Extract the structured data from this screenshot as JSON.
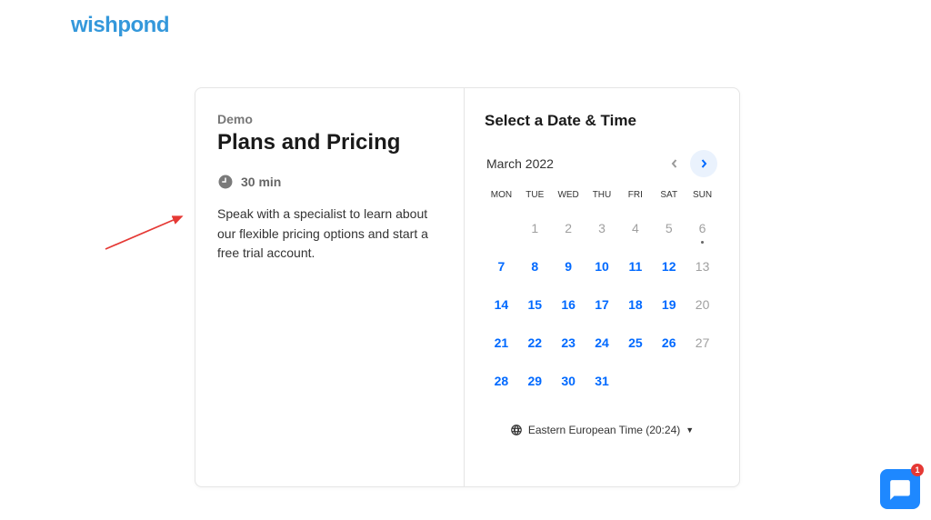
{
  "brand": "wishpond",
  "panel": {
    "eyebrow": "Demo",
    "title": "Plans and Pricing",
    "duration": "30 min",
    "description": "Speak with a specialist to learn about our flexible pricing options and start a free trial account."
  },
  "scheduler": {
    "heading": "Select a Date & Time",
    "month": "March 2022",
    "dow": [
      "MON",
      "TUE",
      "WED",
      "THU",
      "FRI",
      "SAT",
      "SUN"
    ],
    "days": [
      {
        "n": "",
        "s": "blank"
      },
      {
        "n": "1",
        "s": "unavail"
      },
      {
        "n": "2",
        "s": "unavail"
      },
      {
        "n": "3",
        "s": "unavail"
      },
      {
        "n": "4",
        "s": "unavail"
      },
      {
        "n": "5",
        "s": "unavail"
      },
      {
        "n": "6",
        "s": "unavail",
        "dot": true
      },
      {
        "n": "7",
        "s": "avail"
      },
      {
        "n": "8",
        "s": "avail"
      },
      {
        "n": "9",
        "s": "avail"
      },
      {
        "n": "10",
        "s": "avail"
      },
      {
        "n": "11",
        "s": "avail"
      },
      {
        "n": "12",
        "s": "avail"
      },
      {
        "n": "13",
        "s": "unavail"
      },
      {
        "n": "14",
        "s": "avail"
      },
      {
        "n": "15",
        "s": "avail"
      },
      {
        "n": "16",
        "s": "avail"
      },
      {
        "n": "17",
        "s": "avail"
      },
      {
        "n": "18",
        "s": "avail"
      },
      {
        "n": "19",
        "s": "avail"
      },
      {
        "n": "20",
        "s": "unavail"
      },
      {
        "n": "21",
        "s": "avail"
      },
      {
        "n": "22",
        "s": "avail"
      },
      {
        "n": "23",
        "s": "avail"
      },
      {
        "n": "24",
        "s": "avail"
      },
      {
        "n": "25",
        "s": "avail"
      },
      {
        "n": "26",
        "s": "avail"
      },
      {
        "n": "27",
        "s": "unavail"
      },
      {
        "n": "28",
        "s": "avail"
      },
      {
        "n": "29",
        "s": "avail"
      },
      {
        "n": "30",
        "s": "avail"
      },
      {
        "n": "31",
        "s": "avail"
      },
      {
        "n": "",
        "s": "blank"
      },
      {
        "n": "",
        "s": "blank"
      },
      {
        "n": "",
        "s": "blank"
      }
    ],
    "timezone": "Eastern European Time (20:24)"
  },
  "chat": {
    "badge": "1"
  }
}
